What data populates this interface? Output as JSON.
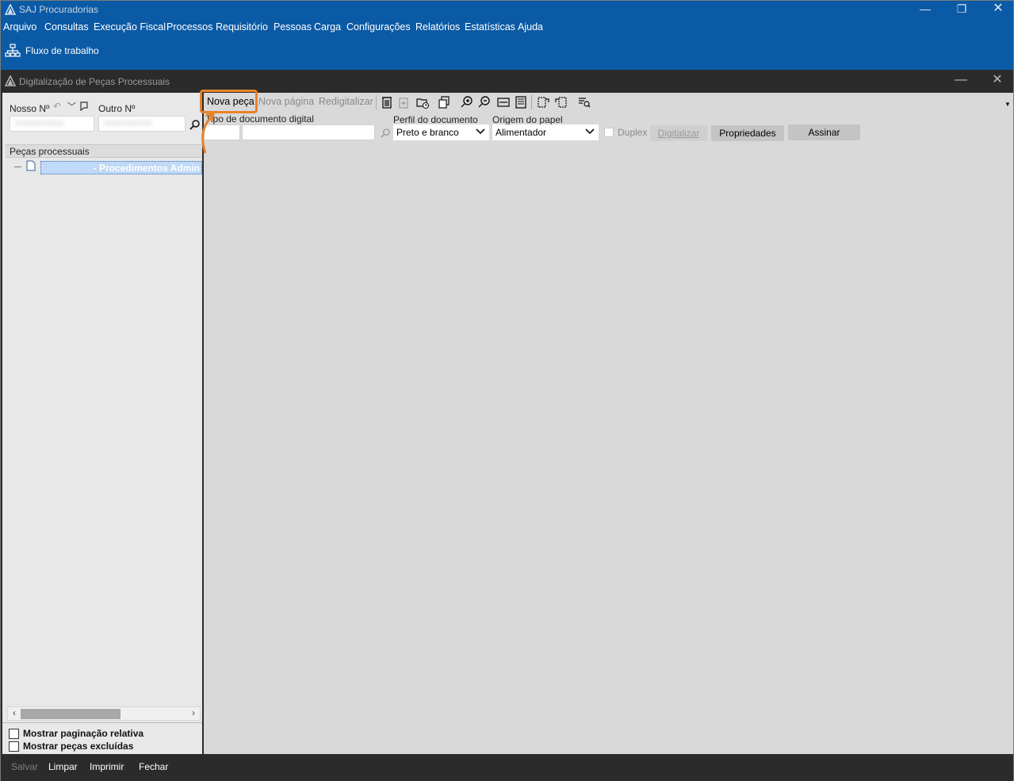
{
  "app": {
    "title": "SAJ Procuradorias",
    "menu": [
      "Arquivo",
      "Consultas",
      "Execução Fiscal",
      "Processos",
      "Requisitório",
      "Pessoas",
      "Carga",
      "Configurações",
      "Relatórios",
      "Estatísticas",
      "Ajuda"
    ],
    "workflow_label": "Fluxo de trabalho"
  },
  "window": {
    "title": "Digitalização de Peças Processuais"
  },
  "search": {
    "nosso_label": "Nosso Nº",
    "outro_label": "Outro Nº"
  },
  "tree": {
    "header": "Peças processuais",
    "item_label": "- Procedimentos Admin"
  },
  "options": {
    "paginacao": "Mostrar paginação relativa",
    "excluidas": "Mostrar peças excluídas"
  },
  "toolbar": {
    "nova_peca": "Nova peça",
    "nova_pagina": "Nova página",
    "redigitalizar": "Redigitalizar"
  },
  "form": {
    "tipo_label": "Tipo de documento digital",
    "perfil_label": "Perfil do documento",
    "perfil_value": "Preto e branco",
    "origem_label": "Origem do papel",
    "origem_value": "Alimentador",
    "duplex_label": "Duplex",
    "digitalizar_label": "Digitalizar",
    "propriedades_label": "Propriedades",
    "assinar_label": "Assinar"
  },
  "footer": {
    "salvar": "Salvar",
    "limpar": "Limpar",
    "imprimir": "Imprimir",
    "fechar": "Fechar"
  },
  "colors": {
    "brand_blue": "#0b5aa6",
    "highlight": "#e8822a",
    "dark_chrome": "#2b2b2b"
  }
}
